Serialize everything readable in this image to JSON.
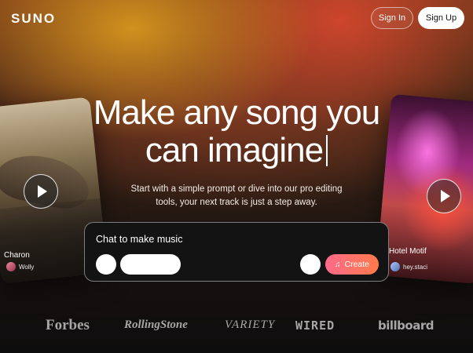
{
  "header": {
    "logo": "SUNO",
    "sign_in_label": "Sign In",
    "sign_up_label": "Sign Up"
  },
  "hero": {
    "headline_line1": "Make any song you",
    "headline_line2": "can imagine",
    "subtitle": "Start with a simple prompt or dive into our pro editing tools, your next track is just a step away."
  },
  "cards": [
    {
      "title": "Charon",
      "artist": "Wolly"
    },
    {
      "title": "Hotel Motif",
      "artist": "hey.staci"
    }
  ],
  "chat": {
    "label": "Chat to make music",
    "create_label": "Create",
    "create_icon": "music-note-icon"
  },
  "press_logos": [
    "Forbes",
    "RollingStone",
    "VARIETY",
    "WIRED",
    "billboard"
  ],
  "colors": {
    "create_gradient_start": "#ff6a8a",
    "create_gradient_end": "#ff7a4a",
    "logo_gray": "#a7a7a7"
  }
}
